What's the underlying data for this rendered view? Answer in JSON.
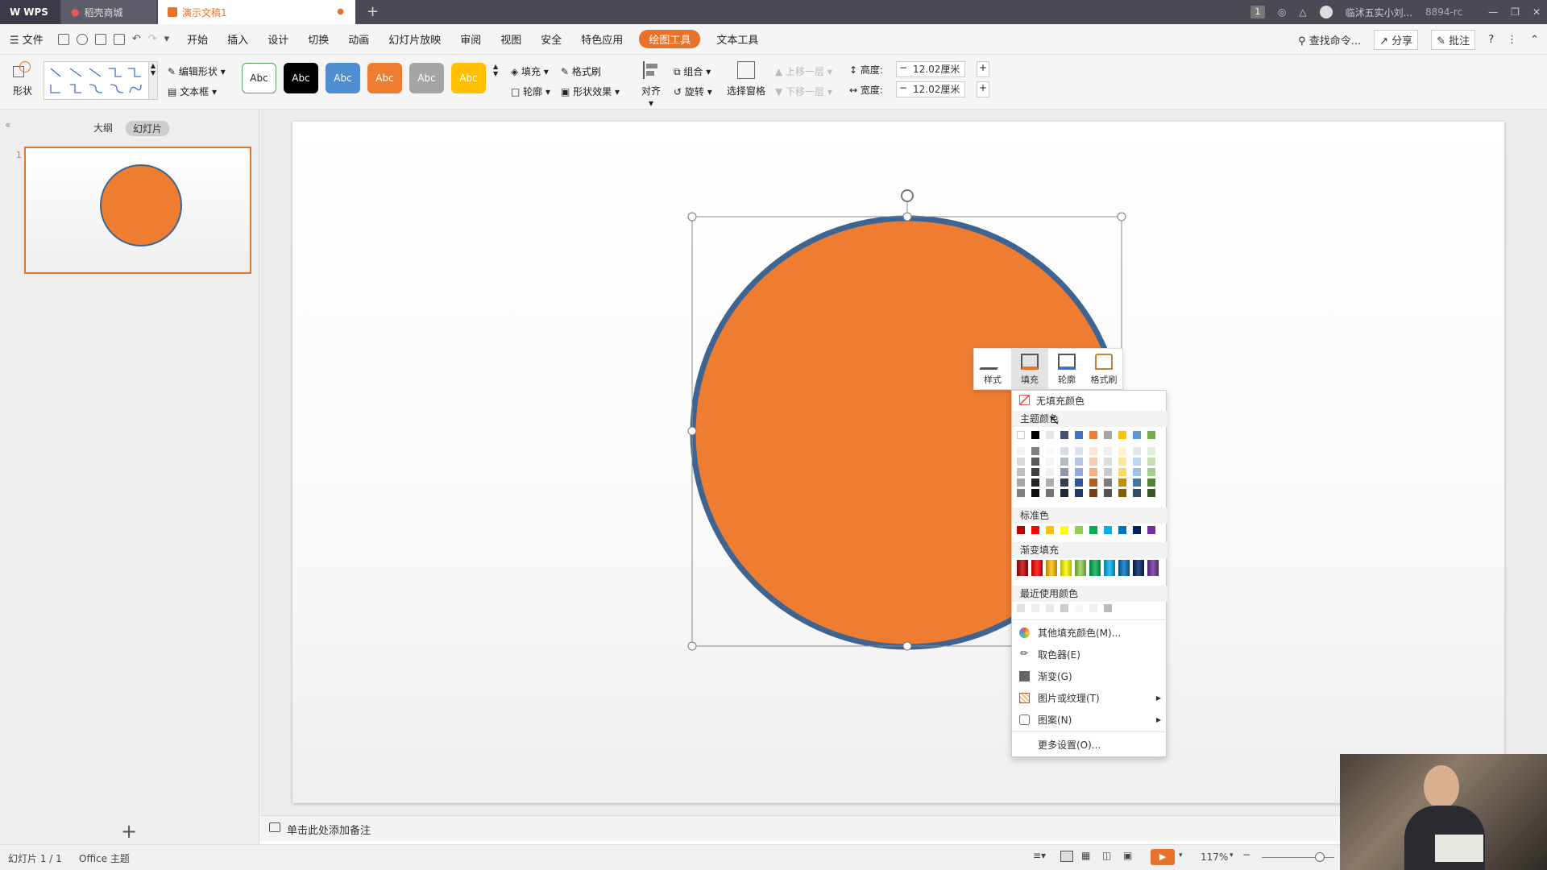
{
  "titlebar": {
    "app": "WPS",
    "tab_store": "稻壳商城",
    "tab_doc": "演示文稿1",
    "badge": "1",
    "user": "临沭五实小刘...",
    "id": "8894-rc"
  },
  "menu": {
    "file": "文件",
    "items": [
      "开始",
      "插入",
      "设计",
      "切换",
      "动画",
      "幻灯片放映",
      "审阅",
      "视图",
      "安全",
      "特色应用"
    ],
    "active": "绘图工具",
    "text_tool": "文本工具",
    "search": "查找命令...",
    "share": "分享",
    "comment": "批注"
  },
  "ribbon": {
    "shape": "形状",
    "edit_shape": "编辑形状",
    "textbox": "文本框",
    "style_labels": [
      "Abc",
      "Abc",
      "Abc",
      "Abc",
      "Abc",
      "Abc"
    ],
    "fill": "填充",
    "outline": "轮廓",
    "format_painter": "格式刷",
    "shape_effect": "形状效果",
    "align": "对齐",
    "group": "组合",
    "rotate": "旋转",
    "selection_pane": "选择窗格",
    "bring_forward": "上移一层",
    "send_backward": "下移一层",
    "height_label": "高度:",
    "height_value": "12.02厘米",
    "width_label": "宽度:",
    "width_value": "12.02厘米"
  },
  "leftpanel": {
    "outline_tab": "大纲",
    "slides_tab": "幻灯片",
    "slide_number": "1"
  },
  "mini_toolbar": {
    "style": "样式",
    "fill": "填充",
    "outline": "轮廓",
    "painter": "格式刷"
  },
  "dropdown": {
    "no_fill": "无填充颜色",
    "theme_colors": "主题颜色",
    "standard_colors": "标准色",
    "gradient_fill": "渐变填充",
    "recent_colors": "最近使用颜色",
    "more_fill": "其他填充颜色(M)...",
    "eyedropper": "取色器(E)",
    "gradient": "渐变(G)",
    "picture_texture": "图片或纹理(T)",
    "pattern": "图案(N)",
    "more_settings": "更多设置(O)..."
  },
  "colors": {
    "accent": "#e8722a",
    "shape_fill": "#ef7d31",
    "shape_outline": "#3e6591",
    "theme_top": [
      "#ffffff",
      "#000000",
      "#e7e6e6",
      "#44546a",
      "#4472c4",
      "#ed7d31",
      "#a5a5a5",
      "#ffc000",
      "#5b9bd5",
      "#70ad47"
    ],
    "standard": [
      "#c00000",
      "#ff0000",
      "#ffc000",
      "#ffff00",
      "#92d050",
      "#00b050",
      "#00b0f0",
      "#0070c0",
      "#002060",
      "#7030a0"
    ],
    "recent": [
      "#e0e0e0",
      "#eeeeee",
      "#e8e8e8",
      "#cccccc",
      "#f8f8f8",
      "#f0f0f0",
      "#bbbbbb"
    ]
  },
  "notes": {
    "placeholder": "单击此处添加备注"
  },
  "status": {
    "slide_count": "幻灯片 1 / 1",
    "theme": "Office 主题",
    "zoom": "117%"
  }
}
